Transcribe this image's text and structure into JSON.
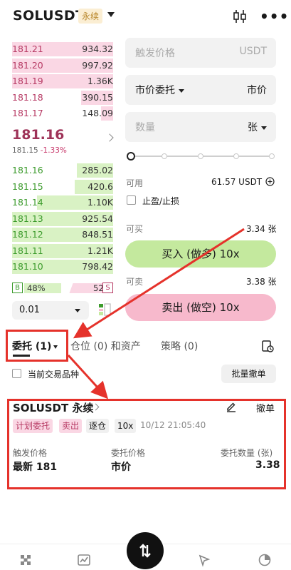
{
  "header": {
    "symbol": "SOLUSDT",
    "badge": "永续",
    "chart_icon": "candlestick-icon",
    "more_icon": "more-dots-icon"
  },
  "order_book": {
    "asks": [
      {
        "price": "181.21",
        "qty": "934.32",
        "depth": 1.0
      },
      {
        "price": "181.20",
        "qty": "997.92",
        "depth": 1.0
      },
      {
        "price": "181.19",
        "qty": "1.36K",
        "depth": 1.0
      },
      {
        "price": "181.18",
        "qty": "390.15",
        "depth": 0.32
      },
      {
        "price": "181.17",
        "qty": "148.09",
        "depth": 0.12
      }
    ],
    "last_price": "181.16",
    "mark_price": "181.15",
    "change_pct": "-1.33%",
    "bids": [
      {
        "price": "181.16",
        "qty": "285.02",
        "depth": 0.36
      },
      {
        "price": "181.15",
        "qty": "420.6",
        "depth": 0.38
      },
      {
        "price": "181.14",
        "qty": "1.10K",
        "depth": 0.75
      },
      {
        "price": "181.13",
        "qty": "925.54",
        "depth": 1.0
      },
      {
        "price": "181.12",
        "qty": "848.51",
        "depth": 1.0
      },
      {
        "price": "181.11",
        "qty": "1.21K",
        "depth": 1.0
      },
      {
        "price": "181.10",
        "qty": "798.42",
        "depth": 1.0
      }
    ],
    "buy_label": "B",
    "buy_ratio": "48%",
    "sell_label": "S",
    "sell_ratio": "52%",
    "precision": "0.01"
  },
  "form": {
    "trigger_price_placeholder": "触发价格",
    "trigger_unit": "USDT",
    "order_type": "市价委托",
    "price_mode": "市价",
    "quantity_placeholder": "数量",
    "quantity_unit": "张",
    "slider_level": 0,
    "available_label": "可用",
    "available_value": "61.57 USDT",
    "tp_sl_label": "止盈/止损",
    "can_buy_label": "可买",
    "can_buy_value": "3.34 张",
    "buy_button": "买入 (做多) 10x",
    "can_sell_label": "可卖",
    "can_sell_value": "3.38 张",
    "sell_button": "卖出 (做空) 10x"
  },
  "tabs": {
    "orders": "委托 (1)",
    "positions": "仓位 (0) 和资产",
    "strategy": "策略 (0)"
  },
  "filter": {
    "current_symbol_label": "当前交易品种",
    "batch_cancel": "批量撤单"
  },
  "order_card": {
    "title": "SOLUSDT 永续",
    "cancel": "撤单",
    "tags": [
      "计划委托",
      "卖出",
      "逐仓",
      "10x"
    ],
    "time": "10/12 21:05:40",
    "trigger_label": "触发价格",
    "trigger_value": "最新 181",
    "order_price_label": "委托价格",
    "order_price_value": "市价",
    "order_qty_label": "委托数量 (张)",
    "order_qty_value": "3.38"
  },
  "colors": {
    "buy": "#3c9b2c",
    "sell": "#b73a64",
    "annotation": "#e5322b"
  }
}
